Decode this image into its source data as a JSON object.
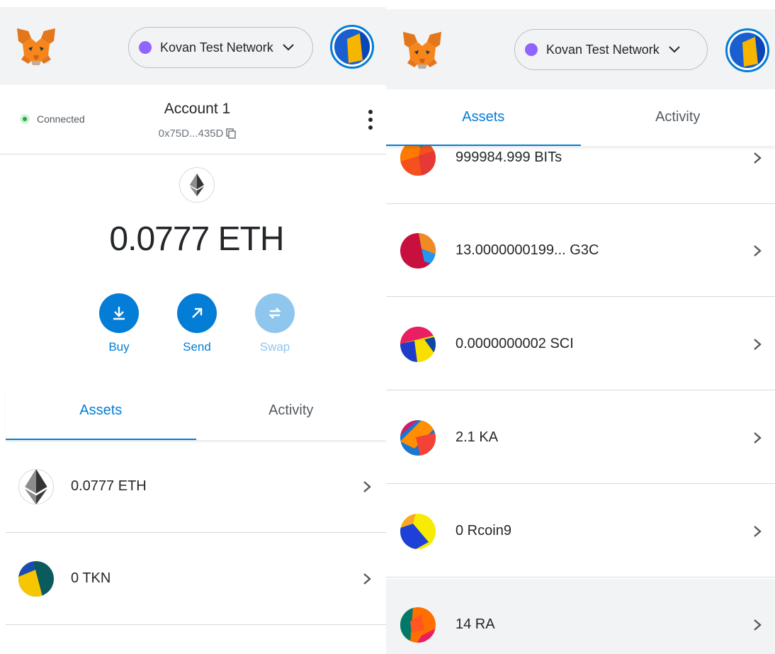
{
  "left": {
    "network": {
      "label": "Kovan Test Network",
      "dot_color": "#9064ff"
    },
    "account": {
      "status": "Connected",
      "name": "Account 1",
      "address": "0x75D...435D"
    },
    "balance": "0.0777 ETH",
    "actions": [
      {
        "label": "Buy",
        "icon": "download-icon"
      },
      {
        "label": "Send",
        "icon": "arrow-up-right-icon"
      },
      {
        "label": "Swap",
        "icon": "swap-icon"
      }
    ],
    "tabs": [
      {
        "label": "Assets",
        "active": true
      },
      {
        "label": "Activity",
        "active": false
      }
    ],
    "assets": [
      {
        "amount": "0.0777 ETH",
        "icon": "ethereum-icon"
      },
      {
        "amount": "0 TKN",
        "icon": "token-identicon"
      }
    ]
  },
  "right": {
    "network": {
      "label": "Kovan Test Network",
      "dot_color": "#9064ff"
    },
    "tabs": [
      {
        "label": "Assets",
        "active": true
      },
      {
        "label": "Activity",
        "active": false
      }
    ],
    "assets": [
      {
        "amount": "999984.999 BITs",
        "icon": "token-identicon"
      },
      {
        "amount": "13.0000000199...  G3C",
        "icon": "token-identicon"
      },
      {
        "amount": "0.0000000002 SCI",
        "icon": "token-identicon"
      },
      {
        "amount": "2.1 KA",
        "icon": "token-identicon"
      },
      {
        "amount": "0 Rcoin9",
        "icon": "token-identicon"
      },
      {
        "amount": "14 RA",
        "icon": "token-identicon"
      }
    ]
  },
  "colors": {
    "accent": "#037dd6",
    "accent_faded": "#8ec6ee",
    "header_bg": "#f2f3f4",
    "connected": "#28a745"
  }
}
